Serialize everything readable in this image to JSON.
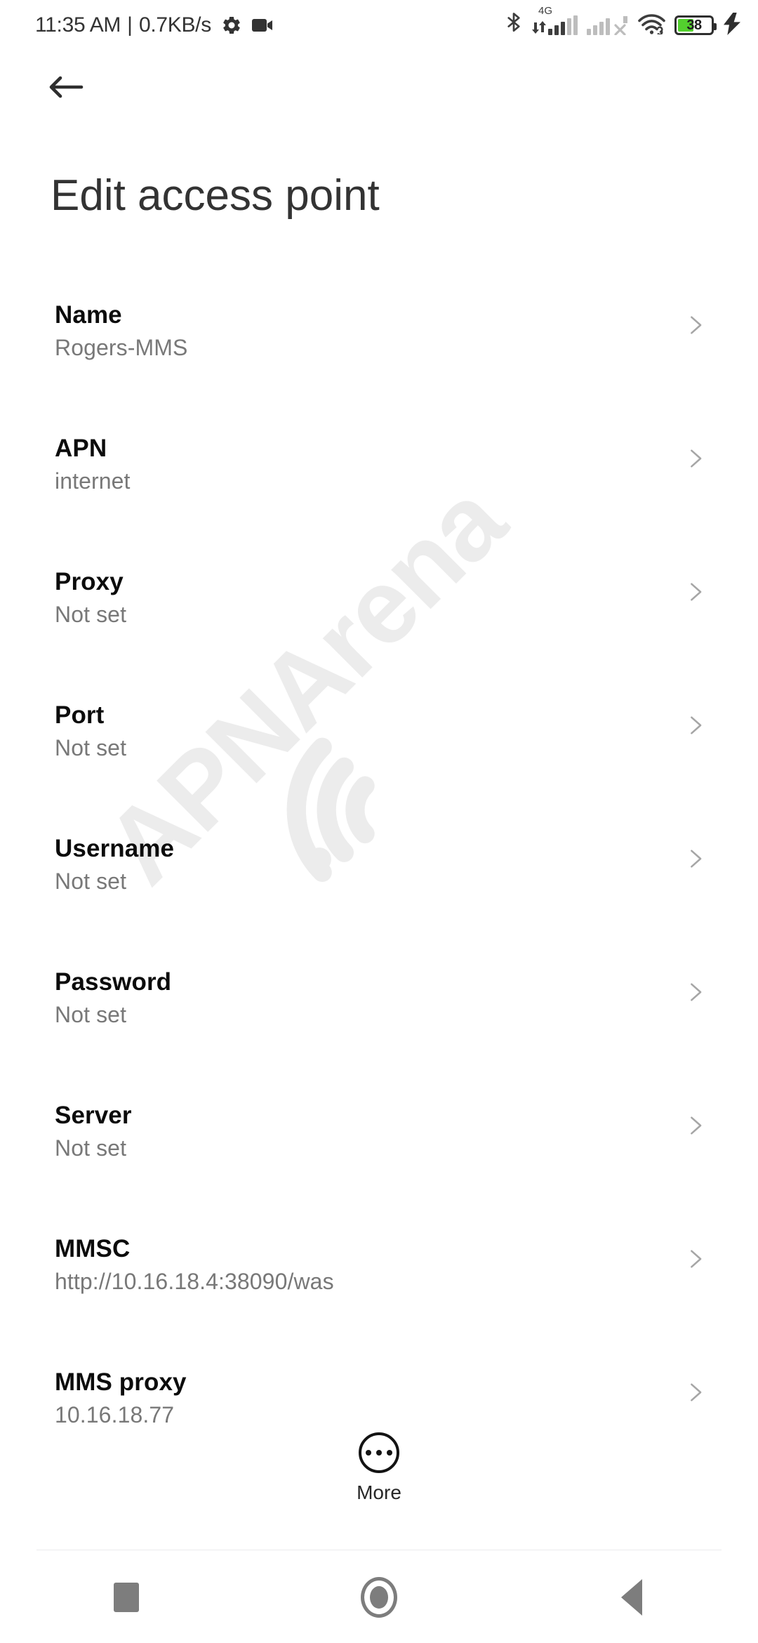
{
  "status_bar": {
    "clock": "11:35 AM",
    "separator": "|",
    "net_speed": "0.7KB/s",
    "left_icons": [
      "gear-icon",
      "video-camera-icon"
    ],
    "right_icons": [
      "bluetooth-icon",
      "signal-4g-icon",
      "signal-sim2-off-icon",
      "wifi-link-icon",
      "battery-icon",
      "charging-bolt-icon"
    ],
    "network_type": "4G",
    "battery_percent": "38",
    "battery_color": "#53d02e"
  },
  "header": {
    "back_icon": "arrow-left-icon",
    "title": "Edit access point"
  },
  "watermark": {
    "text": "APNArena",
    "color": "#ececec"
  },
  "settings": {
    "rows": [
      {
        "label": "Name",
        "value": "Rogers-MMS"
      },
      {
        "label": "APN",
        "value": "internet"
      },
      {
        "label": "Proxy",
        "value": "Not set"
      },
      {
        "label": "Port",
        "value": "Not set"
      },
      {
        "label": "Username",
        "value": "Not set"
      },
      {
        "label": "Password",
        "value": "Not set"
      },
      {
        "label": "Server",
        "value": "Not set"
      },
      {
        "label": "MMSC",
        "value": "http://10.16.18.4:38090/was"
      },
      {
        "label": "MMS proxy",
        "value": "10.16.18.77"
      }
    ]
  },
  "more": {
    "label": "More",
    "icon": "more-dots-icon"
  },
  "nav_bar": {
    "recents_label": "recents-button",
    "home_label": "home-button",
    "back_label": "back-button"
  }
}
